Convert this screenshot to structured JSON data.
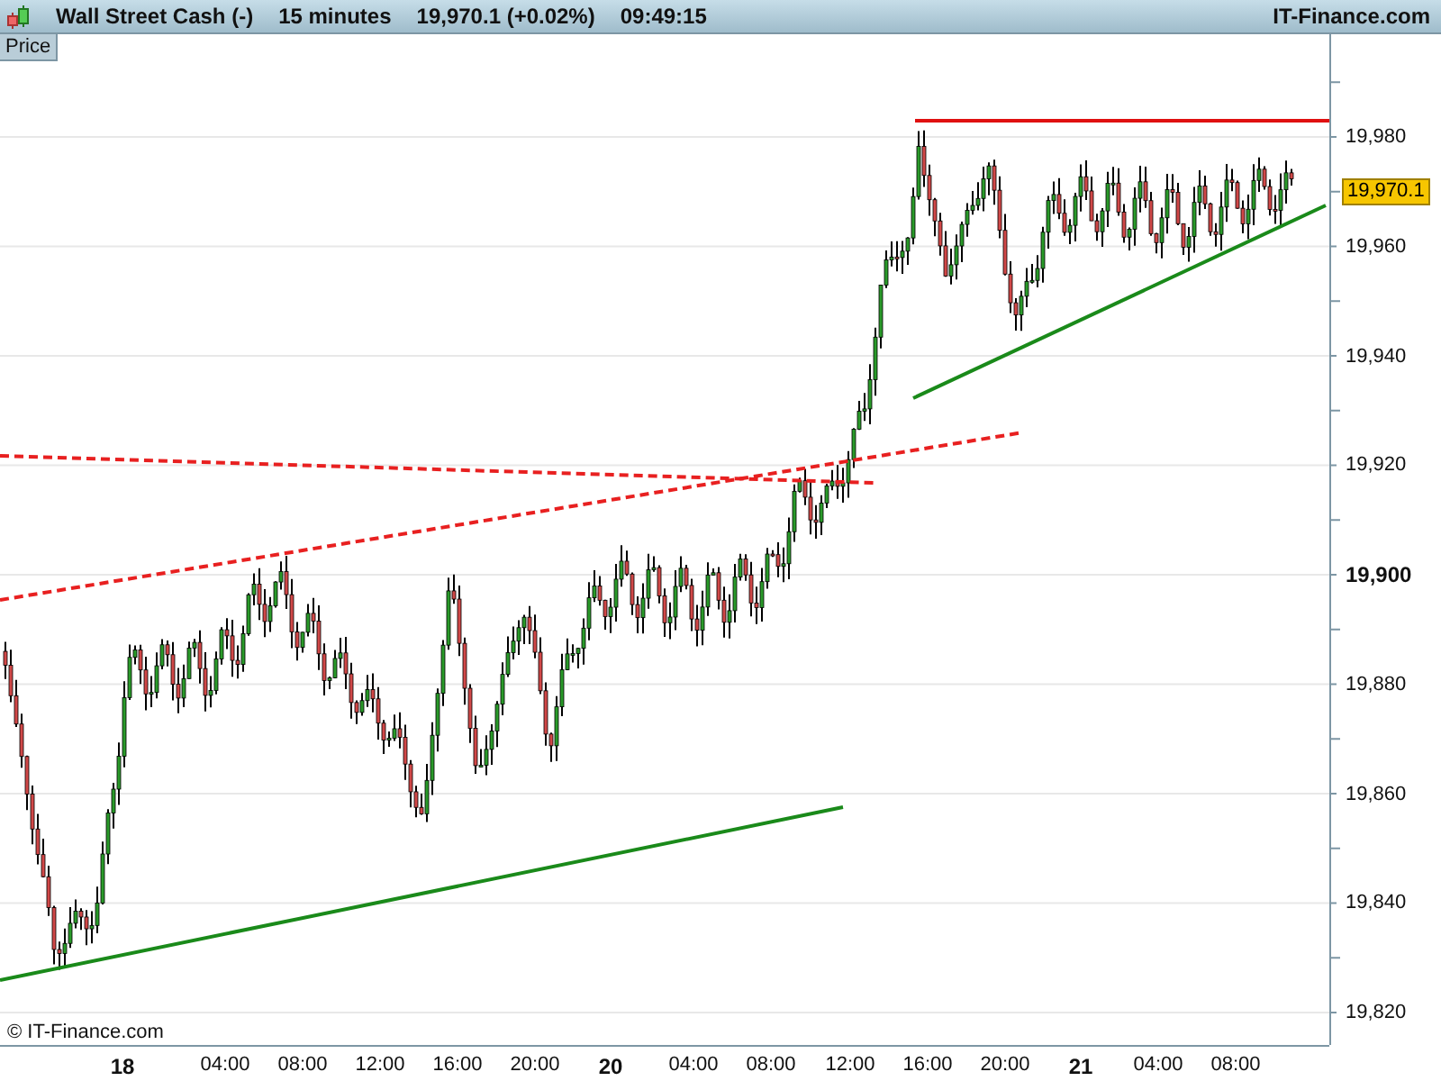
{
  "header": {
    "instrument": "Wall Street Cash (-)",
    "interval": "15 minutes",
    "price": "19,970.1 (+0.02%)",
    "time": "09:49:15",
    "site": "IT-Finance.com"
  },
  "pane_tab": {
    "label": "Price",
    "selected": true
  },
  "copyright": "© IT-Finance.com",
  "current_price": "19,970.1",
  "y_axis": [
    {
      "label": "19,980",
      "major": false
    },
    {
      "label": "19,960",
      "major": false
    },
    {
      "label": "19,940",
      "major": false
    },
    {
      "label": "19,920",
      "major": false
    },
    {
      "label": "19,900",
      "major": true
    },
    {
      "label": "19,880",
      "major": false
    },
    {
      "label": "19,860",
      "major": false
    },
    {
      "label": "19,840",
      "major": false
    },
    {
      "label": "19,820",
      "major": false
    }
  ],
  "x_axis": [
    {
      "label": "18",
      "kind": "day"
    },
    {
      "label": "04:00",
      "kind": "time"
    },
    {
      "label": "08:00",
      "kind": "time"
    },
    {
      "label": "12:00",
      "kind": "time"
    },
    {
      "label": "16:00",
      "kind": "time"
    },
    {
      "label": "20:00",
      "kind": "time"
    },
    {
      "label": "20",
      "kind": "day"
    },
    {
      "label": "04:00",
      "kind": "time"
    },
    {
      "label": "08:00",
      "kind": "time"
    },
    {
      "label": "12:00",
      "kind": "time"
    },
    {
      "label": "16:00",
      "kind": "time"
    },
    {
      "label": "20:00",
      "kind": "time"
    },
    {
      "label": "21",
      "kind": "day"
    },
    {
      "label": "04:00",
      "kind": "time"
    },
    {
      "label": "08:00",
      "kind": "time"
    }
  ]
}
